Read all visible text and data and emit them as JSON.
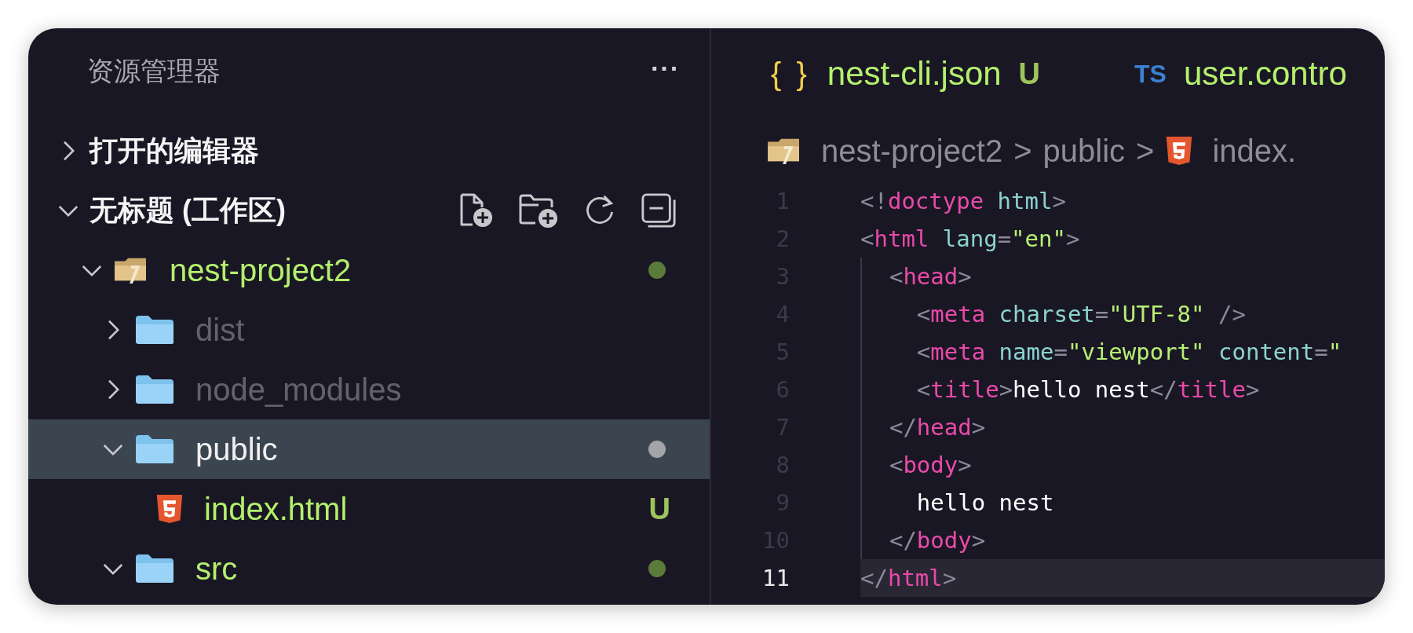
{
  "explorer": {
    "title": "资源管理器",
    "more": "···",
    "sections": [
      {
        "label": "打开的编辑器",
        "expanded": false
      },
      {
        "label": "无标题 (工作区)",
        "expanded": true,
        "tree": [
          {
            "name": "nest-project2",
            "kind": "root-folder",
            "expanded": true,
            "selected": false,
            "untracked": true,
            "ignored": false,
            "color": "#5b7b3a",
            "children": [
              {
                "name": "dist",
                "kind": "folder",
                "expanded": false,
                "selected": false,
                "untracked": false,
                "ignored": true
              },
              {
                "name": "node_modules",
                "kind": "folder",
                "expanded": false,
                "selected": false,
                "untracked": false,
                "ignored": true
              },
              {
                "name": "public",
                "kind": "folder",
                "expanded": true,
                "selected": true,
                "untracked": false,
                "ignored": false,
                "color": "#a3a3a8",
                "children": [
                  {
                    "name": "index.html",
                    "kind": "html-file",
                    "selected": false,
                    "untracked": true,
                    "ignored": false,
                    "badge": "U"
                  }
                ]
              },
              {
                "name": "src",
                "kind": "folder",
                "expanded": true,
                "selected": false,
                "untracked": true,
                "ignored": false,
                "color": "#5b7b3a"
              }
            ]
          }
        ]
      }
    ]
  },
  "editor": {
    "tabs": [
      {
        "icon_text": "{ }",
        "kind": "json",
        "label": "nest-cli.json",
        "badge": "U"
      },
      {
        "icon_text": "TS",
        "kind": "ts",
        "label": "user.contro"
      }
    ],
    "breadcrumbs": [
      {
        "label": "nest-project2",
        "kind": "root-folder"
      },
      {
        "label": "public",
        "kind": "none"
      },
      {
        "label": "index.",
        "kind": "html-file"
      }
    ],
    "separator": ">",
    "lines": [
      {
        "number": "1",
        "current": false,
        "tokens": [
          {
            "text": "<!",
            "kind": "punct"
          },
          {
            "text": "doctype",
            "kind": "tag"
          },
          {
            "text": " html",
            "kind": "attr"
          },
          {
            "text": ">",
            "kind": "punct"
          }
        ]
      },
      {
        "number": "2",
        "current": false,
        "tokens": [
          {
            "text": "<",
            "kind": "punct"
          },
          {
            "text": "html",
            "kind": "tag"
          },
          {
            "text": " lang",
            "kind": "attr"
          },
          {
            "text": "=",
            "kind": "punct"
          },
          {
            "text": "\"en\"",
            "kind": "string"
          },
          {
            "text": ">",
            "kind": "punct"
          }
        ]
      },
      {
        "number": "3",
        "current": false,
        "tokens": [
          {
            "text": "  <",
            "kind": "punct"
          },
          {
            "text": "head",
            "kind": "tag"
          },
          {
            "text": ">",
            "kind": "punct"
          }
        ]
      },
      {
        "number": "4",
        "current": false,
        "tokens": [
          {
            "text": "    <",
            "kind": "punct"
          },
          {
            "text": "meta",
            "kind": "tag"
          },
          {
            "text": " charset",
            "kind": "attr"
          },
          {
            "text": "=",
            "kind": "punct"
          },
          {
            "text": "\"UTF-8\"",
            "kind": "string"
          },
          {
            "text": " />",
            "kind": "punct"
          }
        ]
      },
      {
        "number": "5",
        "current": false,
        "tokens": [
          {
            "text": "    <",
            "kind": "punct"
          },
          {
            "text": "meta",
            "kind": "tag"
          },
          {
            "text": " name",
            "kind": "attr"
          },
          {
            "text": "=",
            "kind": "punct"
          },
          {
            "text": "\"viewport\"",
            "kind": "string"
          },
          {
            "text": " content",
            "kind": "attr"
          },
          {
            "text": "=",
            "kind": "punct"
          },
          {
            "text": "\"",
            "kind": "string"
          }
        ]
      },
      {
        "number": "6",
        "current": false,
        "tokens": [
          {
            "text": "    <",
            "kind": "punct"
          },
          {
            "text": "title",
            "kind": "tag"
          },
          {
            "text": ">",
            "kind": "punct"
          },
          {
            "text": "hello nest",
            "kind": "text"
          },
          {
            "text": "</",
            "kind": "punct"
          },
          {
            "text": "title",
            "kind": "tag"
          },
          {
            "text": ">",
            "kind": "punct"
          }
        ]
      },
      {
        "number": "7",
        "current": false,
        "tokens": [
          {
            "text": "  </",
            "kind": "punct"
          },
          {
            "text": "head",
            "kind": "tag"
          },
          {
            "text": ">",
            "kind": "punct"
          }
        ]
      },
      {
        "number": "8",
        "current": false,
        "tokens": [
          {
            "text": "  <",
            "kind": "punct"
          },
          {
            "text": "body",
            "kind": "tag"
          },
          {
            "text": ">",
            "kind": "punct"
          }
        ]
      },
      {
        "number": "9",
        "current": false,
        "tokens": [
          {
            "text": "    hello nest",
            "kind": "text"
          }
        ]
      },
      {
        "number": "10",
        "current": false,
        "tokens": [
          {
            "text": "  </",
            "kind": "punct"
          },
          {
            "text": "body",
            "kind": "tag"
          },
          {
            "text": ">",
            "kind": "punct"
          }
        ]
      },
      {
        "number": "11",
        "current": true,
        "tokens": [
          {
            "text": "</",
            "kind": "punct"
          },
          {
            "text": "html",
            "kind": "tag"
          },
          {
            "text": ">",
            "kind": "punct"
          }
        ]
      }
    ]
  }
}
